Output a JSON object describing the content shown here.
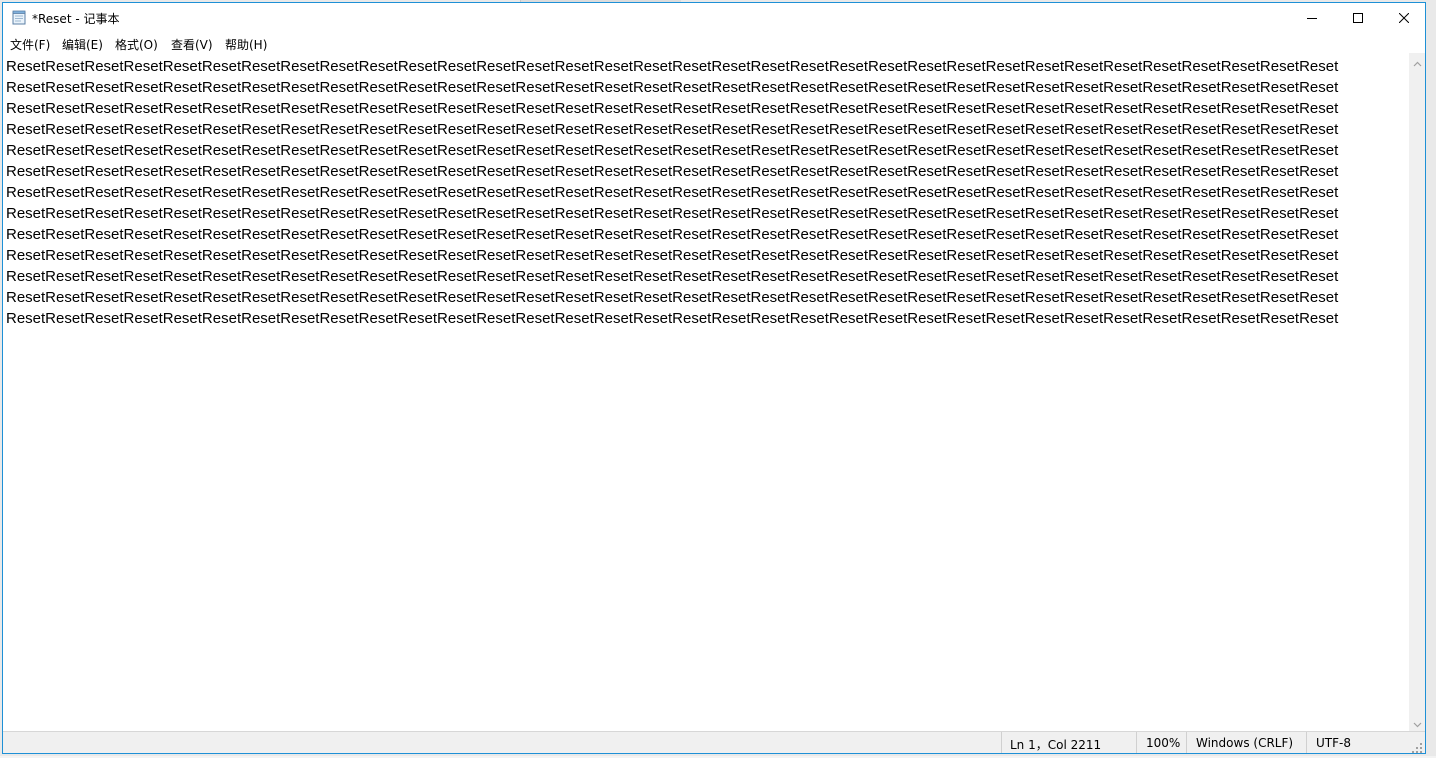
{
  "window": {
    "title": "*Reset - 记事本",
    "icon": "notepad-icon",
    "controls": {
      "minimize": "minimize-icon",
      "maximize": "maximize-icon",
      "close": "close-icon"
    }
  },
  "menu": {
    "items": [
      {
        "label": "文件(F)"
      },
      {
        "label": "编辑(E)"
      },
      {
        "label": "格式(O)"
      },
      {
        "label": "查看(V)"
      },
      {
        "label": "帮助(H)"
      }
    ]
  },
  "editor": {
    "lines": [
      "ResetResetResetResetResetResetResetResetResetResetResetResetResetResetResetResetResetResetResetResetResetResetResetResetResetResetResetResetResetResetResetResetResetReset",
      "ResetResetResetResetResetResetResetResetResetResetResetResetResetResetResetResetResetResetResetResetResetResetResetResetResetResetResetResetResetResetResetResetResetReset",
      "ResetResetResetResetResetResetResetResetResetResetResetResetResetResetResetResetResetResetResetResetResetResetResetResetResetResetResetResetResetResetResetResetResetReset",
      "ResetResetResetResetResetResetResetResetResetResetResetResetResetResetResetResetResetResetResetResetResetResetResetResetResetResetResetResetResetResetResetResetResetReset",
      "ResetResetResetResetResetResetResetResetResetResetResetResetResetResetResetResetResetResetResetResetResetResetResetResetResetResetResetResetResetResetResetResetResetReset",
      "ResetResetResetResetResetResetResetResetResetResetResetResetResetResetResetResetResetResetResetResetResetResetResetResetResetResetResetResetResetResetResetResetResetReset",
      "ResetResetResetResetResetResetResetResetResetResetResetResetResetResetResetResetResetResetResetResetResetResetResetResetResetResetResetResetResetResetResetResetResetReset",
      "ResetResetResetResetResetResetResetResetResetResetResetResetResetResetResetResetResetResetResetResetResetResetResetResetResetResetResetResetResetResetResetResetResetReset",
      "ResetResetResetResetResetResetResetResetResetResetResetResetResetResetResetResetResetResetResetResetResetResetResetResetResetResetResetResetResetResetResetResetResetReset",
      "ResetResetResetResetResetResetResetResetResetResetResetResetResetResetResetResetResetResetResetResetResetResetResetResetResetResetResetResetResetResetResetResetResetReset",
      "ResetResetResetResetResetResetResetResetResetResetResetResetResetResetResetResetResetResetResetResetResetResetResetResetResetResetResetResetResetResetResetResetResetReset",
      "ResetResetResetResetResetResetResetResetResetResetResetResetResetResetResetResetResetResetResetResetResetResetResetResetResetResetResetResetResetResetResetResetResetReset",
      "ResetResetResetResetResetResetResetResetResetResetResetResetResetResetResetResetResetResetResetResetResetResetResetResetResetResetResetResetResetResetResetResetResetReset"
    ]
  },
  "scrollbar": {
    "up_icon": "scroll-up-arrow-icon",
    "down_icon": "scroll-down-arrow-icon"
  },
  "status": {
    "position": "Ln 1，Col 2211",
    "zoom": "100%",
    "line_ending": "Windows (CRLF)",
    "encoding": "UTF-8"
  },
  "colors": {
    "window_border": "#1e90d6",
    "statusbar_bg": "#f0f0f0"
  }
}
